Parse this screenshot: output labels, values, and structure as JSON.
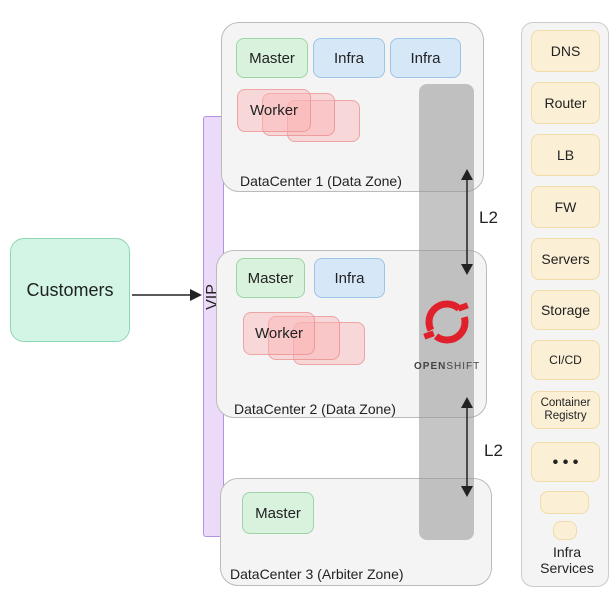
{
  "customers": "Customers",
  "vip": "VIP",
  "dc1": {
    "label": "DataCenter 1 (Data Zone)",
    "master": "Master",
    "infra1": "Infra",
    "infra2": "Infra",
    "worker": "Worker"
  },
  "dc2": {
    "label": "DataCenter 2 (Data Zone)",
    "master": "Master",
    "infra": "Infra",
    "worker": "Worker"
  },
  "dc3": {
    "label": "DataCenter 3 (Arbiter Zone)",
    "master": "Master"
  },
  "openshift": {
    "open": "OPEN",
    "shift": "SHIFT",
    "color": "#e0202a"
  },
  "links": [
    "L2",
    "L2"
  ],
  "infra_services": {
    "title": "Infra Services",
    "items": [
      "DNS",
      "Router",
      "LB",
      "FW",
      "Servers",
      "Storage",
      "CI/CD",
      "Container Registry",
      "• • •"
    ]
  }
}
